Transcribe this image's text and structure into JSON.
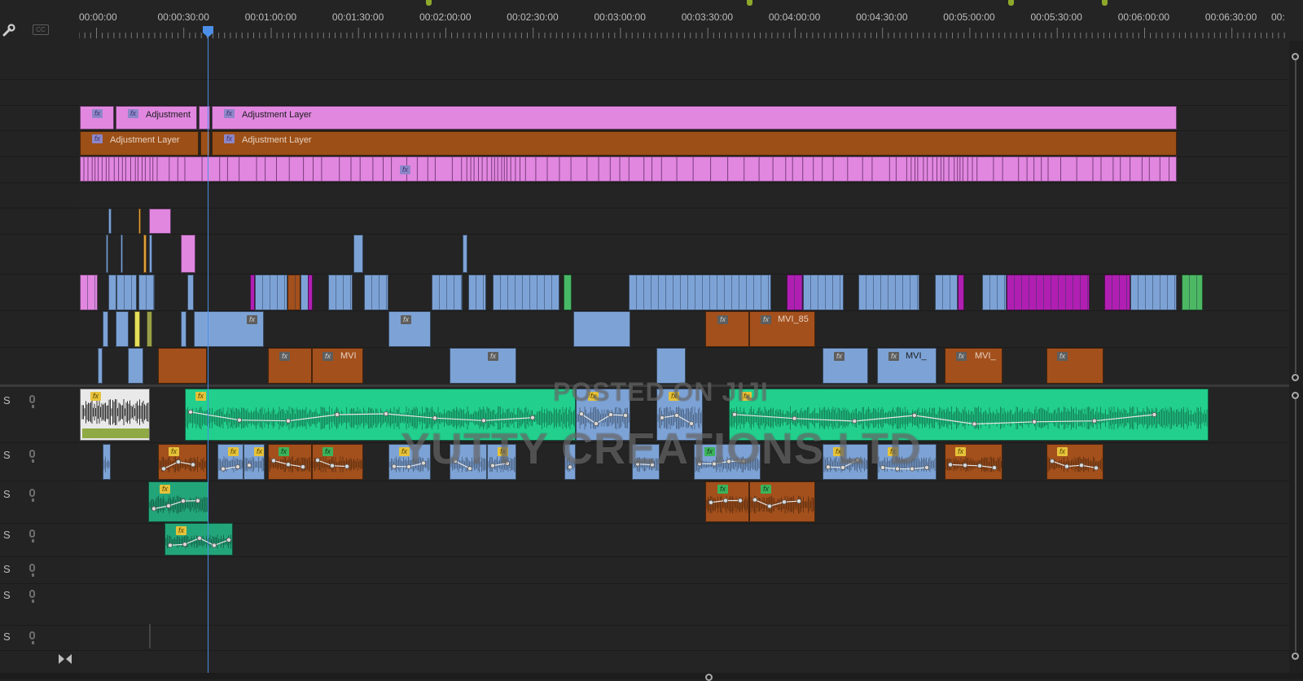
{
  "timecodes": [
    "00:00:00",
    "00:00:30:00",
    "00:01:00:00",
    "00:01:30:00",
    "00:02:00:00",
    "00:02:30:00",
    "00:03:00:00",
    "00:03:30:00",
    "00:04:00:00",
    "00:04:30:00",
    "00:05:00:00",
    "00:05:30:00",
    "00:06:00:00",
    "00:06:30:00",
    "00:"
  ],
  "audio_tracks": [
    {
      "solo_label": "S"
    },
    {
      "solo_label": "S"
    },
    {
      "solo_label": "S"
    },
    {
      "solo_label": "S"
    },
    {
      "solo_label": "S"
    },
    {
      "solo_label": "S"
    },
    {
      "solo_label": "S"
    }
  ],
  "clips": {
    "adj1_label": "Adjustment",
    "adj2_label": "Adjustment Layer",
    "adj3_label": "Adjustment Layer",
    "adj4_label": "Adjustment Layer",
    "mvi_a": "MVI",
    "mvi_b": "MVI_85",
    "mvi_c": "MVI_",
    "mvi_d": "MVI_",
    "fx": "fx"
  },
  "watermark": {
    "line1": "POSTED ON JIJI",
    "line2": "YUTTY CREATIONS LTD"
  },
  "colors": {
    "adjustment_pink": "#e187e0",
    "adjustment_orange": "#9c4f16",
    "video_blue": "#7da3d6",
    "video_orange": "#a3501c",
    "magenta": "#b01fb2",
    "audio_green": "#22cf8d",
    "audio_dkgreen": "#23a57a",
    "playhead": "#4c8fe8"
  }
}
